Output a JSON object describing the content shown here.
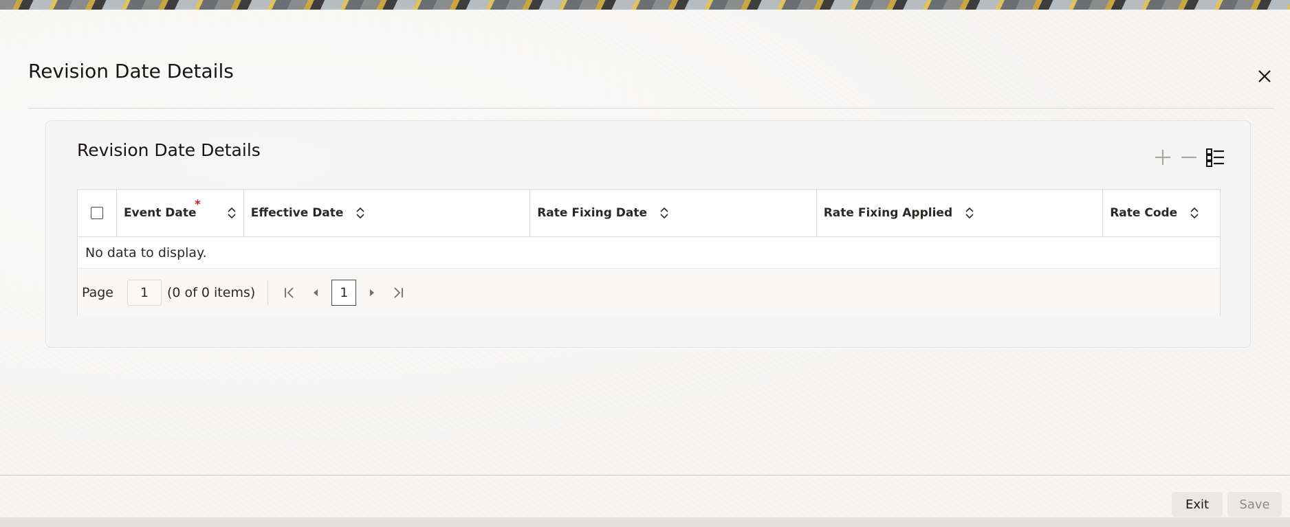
{
  "dialog": {
    "title": "Revision Date Details",
    "close_icon": "close-icon"
  },
  "section": {
    "title": "Revision Date Details",
    "toolbar": {
      "add_icon": "plus-icon",
      "remove_icon": "minus-icon",
      "view_icon": "list-view-icon"
    }
  },
  "grid": {
    "columns": [
      {
        "label": "Event Date",
        "required": true,
        "required_marker": "*"
      },
      {
        "label": "Effective Date",
        "required": false
      },
      {
        "label": "Rate Fixing Date",
        "required": false
      },
      {
        "label": "Rate Fixing Applied",
        "required": false
      },
      {
        "label": "Rate Code",
        "required": false
      }
    ],
    "empty_message": "No data to display."
  },
  "pagination": {
    "page_label": "Page",
    "page_input_value": "1",
    "item_count": "(0 of 0 items)",
    "current_page": "1"
  },
  "footer": {
    "exit_label": "Exit",
    "save_label": "Save"
  },
  "colors": {
    "required": "#b0271e",
    "border": "#dcdad7",
    "disabled_text": "#8d8a86"
  }
}
